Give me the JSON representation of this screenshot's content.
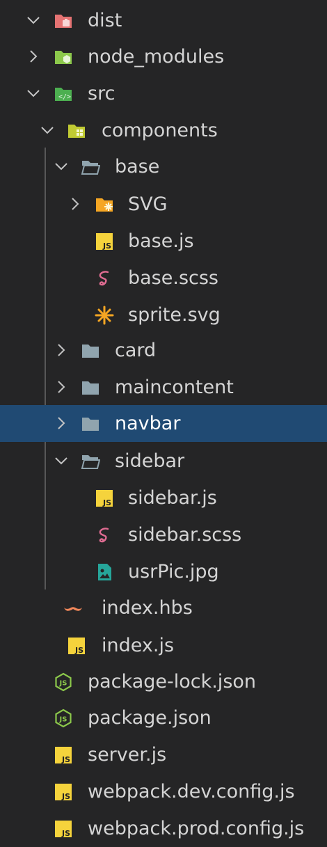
{
  "explorer": {
    "items": [
      {
        "label": "dist",
        "icon": "folder-dist-open-icon",
        "chevron": "open"
      },
      {
        "label": "node_modules",
        "icon": "folder-node-icon",
        "chevron": "closed"
      },
      {
        "label": "src",
        "icon": "folder-src-open-icon",
        "chevron": "open"
      },
      {
        "label": "components",
        "icon": "folder-components-open-icon",
        "chevron": "open"
      },
      {
        "label": "base",
        "icon": "folder-open-icon",
        "chevron": "open"
      },
      {
        "label": "SVG",
        "icon": "folder-svg-icon",
        "chevron": "closed"
      },
      {
        "label": "base.js",
        "icon": "js-file-icon"
      },
      {
        "label": "base.scss",
        "icon": "sass-file-icon"
      },
      {
        "label": "sprite.svg",
        "icon": "svg-file-icon"
      },
      {
        "label": "card",
        "icon": "folder-icon",
        "chevron": "closed"
      },
      {
        "label": "maincontent",
        "icon": "folder-icon",
        "chevron": "closed"
      },
      {
        "label": "navbar",
        "icon": "folder-icon",
        "chevron": "closed",
        "selected": true
      },
      {
        "label": "sidebar",
        "icon": "folder-open-icon",
        "chevron": "open"
      },
      {
        "label": "sidebar.js",
        "icon": "js-file-icon"
      },
      {
        "label": "sidebar.scss",
        "icon": "sass-file-icon"
      },
      {
        "label": "usrPic.jpg",
        "icon": "image-file-icon"
      },
      {
        "label": "index.hbs",
        "icon": "handlebars-file-icon"
      },
      {
        "label": "index.js",
        "icon": "js-file-icon"
      },
      {
        "label": "package-lock.json",
        "icon": "nodejs-file-icon"
      },
      {
        "label": "package.json",
        "icon": "nodejs-file-icon"
      },
      {
        "label": "server.js",
        "icon": "js-file-icon"
      },
      {
        "label": "webpack.dev.config.js",
        "icon": "js-file-icon"
      },
      {
        "label": "webpack.prod.config.js",
        "icon": "js-file-icon"
      }
    ]
  },
  "colors": {
    "background": "#252526",
    "selection": "#204a73",
    "text": "#d4d4d4",
    "folder_gray": "#90a4ae",
    "js_yellow": "#f5d33c",
    "sass_pink": "#e06c92",
    "svg_orange": "#f5a623",
    "node_green": "#8cc84b",
    "dist_red": "#e57373",
    "src_green": "#4caf50",
    "handlebars_orange": "#f0875a",
    "image_teal": "#26a69a"
  }
}
